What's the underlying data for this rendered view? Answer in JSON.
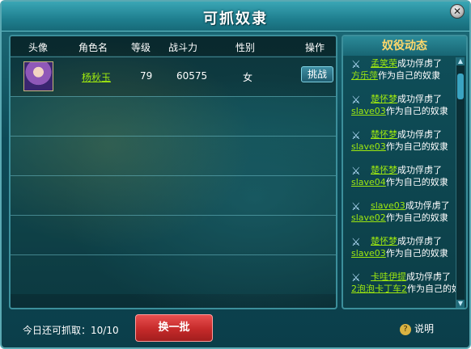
{
  "title": "可抓奴隶",
  "close_label": "✕",
  "table": {
    "headers": [
      "头像",
      "角色名",
      "等级",
      "战斗力",
      "性别",
      "操作"
    ],
    "rows": [
      {
        "name": "杨秋玉",
        "level": "79",
        "power": "60575",
        "gender": "女",
        "action": "挑战"
      }
    ]
  },
  "side": {
    "title": "奴役动态",
    "entries": [
      {
        "captor": "孟笑荣",
        "verb": "成功俘虏了",
        "captive": "方乐萍",
        "suffix": "作为自己的奴隶"
      },
      {
        "captor": "楚怀梦",
        "verb": "成功俘虏了",
        "captive": "slave03",
        "suffix": "作为自己的奴隶"
      },
      {
        "captor": "楚怀梦",
        "verb": "成功俘虏了",
        "captive": "slave03",
        "suffix": "作为自己的奴隶"
      },
      {
        "captor": "楚怀梦",
        "verb": "成功俘虏了",
        "captive": "slave04",
        "suffix": "作为自己的奴隶"
      },
      {
        "captor": "slave03",
        "verb": "成功俘虏了",
        "captive": "slave02",
        "suffix": "作为自己的奴隶"
      },
      {
        "captor": "楚怀梦",
        "verb": "成功俘虏了",
        "captive": "slave03",
        "suffix": "作为自己的奴隶"
      },
      {
        "captor": "卡哇伊提",
        "verb": "成功俘虏了",
        "captive": "2泡泡卡丁车2",
        "suffix": "作为自己的奴隶"
      }
    ]
  },
  "footer": {
    "remaining_label": "今日还可抓取：10/10",
    "refresh_label": "换一批",
    "help_label": "说明",
    "help_icon": "?"
  },
  "colors": {
    "accent": "#9ee80f",
    "button_red": "#c52a2a",
    "gold": "#ffd86b"
  }
}
